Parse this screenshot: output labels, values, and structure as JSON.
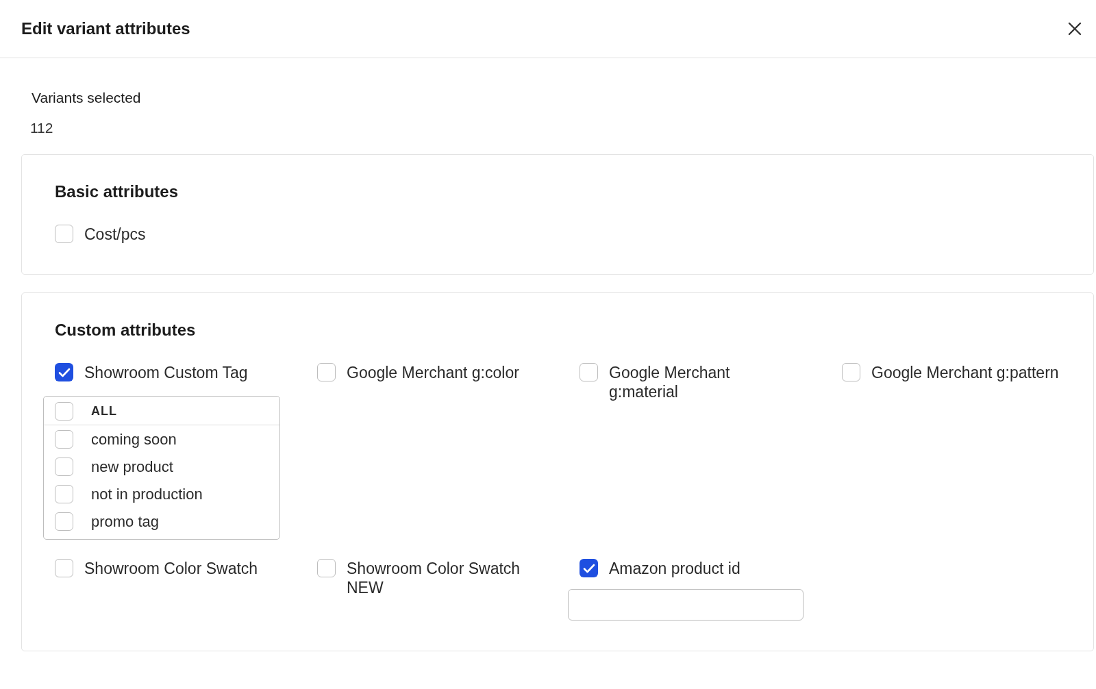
{
  "header": {
    "title": "Edit variant attributes"
  },
  "variants": {
    "label": "Variants selected",
    "value": "112"
  },
  "basic": {
    "title": "Basic attributes",
    "attributes": [
      {
        "label": "Cost/pcs",
        "checked": false,
        "kind": "plain"
      }
    ]
  },
  "custom": {
    "title": "Custom attributes",
    "attributes": [
      {
        "label": "Showroom Custom Tag",
        "checked": true,
        "kind": "options",
        "options": {
          "all": {
            "label": "ALL",
            "checked": false
          },
          "items": [
            {
              "label": "coming soon",
              "checked": false
            },
            {
              "label": "new product",
              "checked": false
            },
            {
              "label": "not in production",
              "checked": false
            },
            {
              "label": "promo tag",
              "checked": false
            }
          ]
        }
      },
      {
        "label": "Google Merchant g:color",
        "checked": false,
        "kind": "plain"
      },
      {
        "label": "Google Merchant g:material",
        "checked": false,
        "kind": "plain"
      },
      {
        "label": "Google Merchant g:pattern",
        "checked": false,
        "kind": "plain"
      },
      {
        "label": "Showroom Color Swatch",
        "checked": false,
        "kind": "plain"
      },
      {
        "label": "Showroom Color Swatch NEW",
        "checked": false,
        "kind": "plain"
      },
      {
        "label": "Amazon product id",
        "checked": true,
        "kind": "text"
      }
    ]
  }
}
